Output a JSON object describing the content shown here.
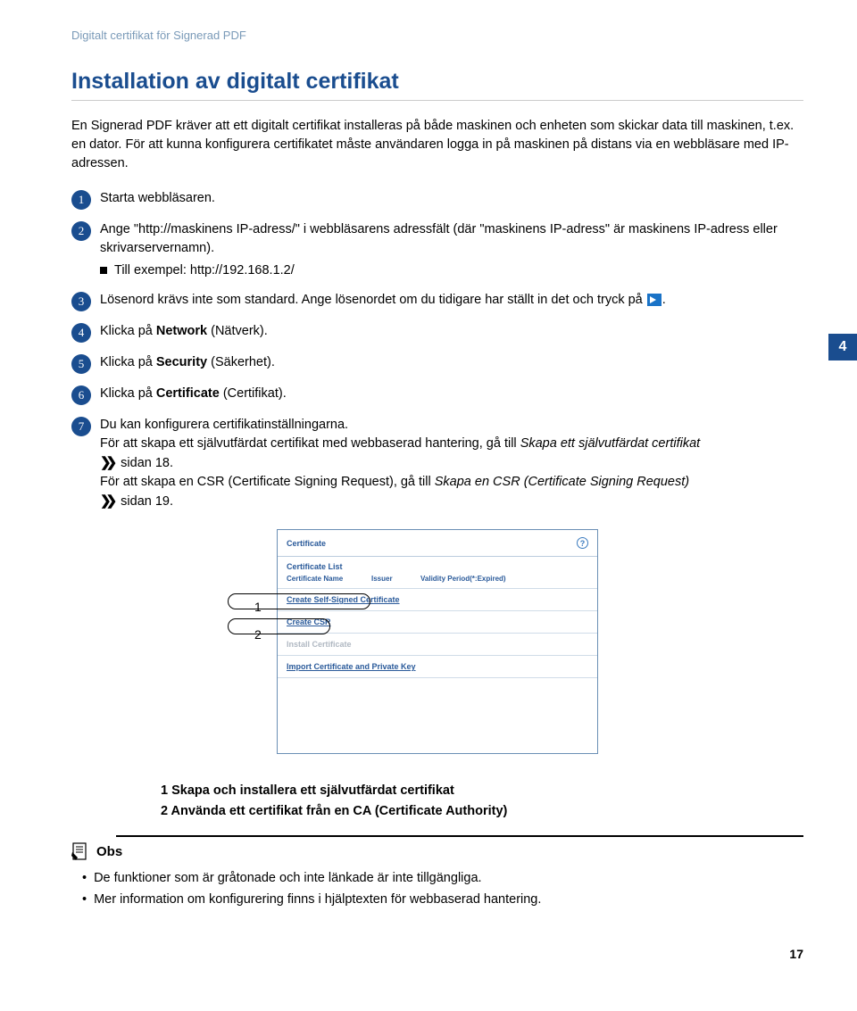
{
  "header": {
    "title": "Digitalt certifikat för Signerad PDF"
  },
  "page_badge": "4",
  "main": {
    "title": "Installation av digitalt certifikat",
    "intro": "En Signerad PDF kräver att ett digitalt certifikat installeras på både maskinen och enheten som skickar data till maskinen, t.ex. en dator. För att kunna konfigurera certifikatet måste användaren logga in på maskinen på distans via en webbläsare med IP-adressen."
  },
  "steps": [
    {
      "n": "1",
      "text": "Starta webbläsaren."
    },
    {
      "n": "2",
      "text": "Ange \"http://maskinens IP-adress/\" i webbläsarens adressfält (där \"maskinens IP-adress\" är maskinens IP-adress eller skrivarservernamn).",
      "sub": "Till exempel: http://192.168.1.2/"
    },
    {
      "n": "3",
      "text_pre": "Lösenord krävs inte som standard. Ange lösenordet om du tidigare har ställt in det och tryck på ",
      "text_post": "."
    },
    {
      "n": "4",
      "text_pre": "Klicka på ",
      "bold": "Network",
      "text_post": " (Nätverk)."
    },
    {
      "n": "5",
      "text_pre": "Klicka på ",
      "bold": "Security",
      "text_post": " (Säkerhet)."
    },
    {
      "n": "6",
      "text_pre": "Klicka på ",
      "bold": "Certificate",
      "text_post": " (Certifikat)."
    },
    {
      "n": "7",
      "line1": "Du kan konfigurera certifikatinställningarna.",
      "line2_pre": "För att skapa ett självutfärdat certifikat med webbaserad hantering, gå till ",
      "line2_em": "Skapa ett självutfärdat certifikat",
      "line2_post_a": " sidan 18.",
      "line3_pre": "För att skapa en CSR (Certificate Signing Request), gå till ",
      "line3_em": "Skapa en CSR (Certificate Signing Request)",
      "line3_post_a": " sidan 19."
    }
  ],
  "figure": {
    "labels": {
      "one": "1",
      "two": "2"
    },
    "title": "Certificate",
    "subtitle": "Certificate List",
    "cols": {
      "name": "Certificate Name",
      "issuer": "Issuer",
      "validity": "Validity Period(*:Expired)"
    },
    "rows": {
      "create_self": "Create Self-Signed Certificate",
      "create_csr": "Create CSR",
      "install": "Install Certificate",
      "import": "Import Certificate and Private Key"
    },
    "help": "?"
  },
  "legend": {
    "l1": "1 Skapa och installera ett självutfärdat certifikat",
    "l2": "2 Använda ett certifikat från en CA (Certificate Authority)"
  },
  "note": {
    "heading": "Obs",
    "items": [
      "De funktioner som är gråtonade och inte länkade är inte tillgängliga.",
      "Mer information om konfigurering finns i hjälptexten för webbaserad hantering."
    ]
  },
  "page_number": "17"
}
